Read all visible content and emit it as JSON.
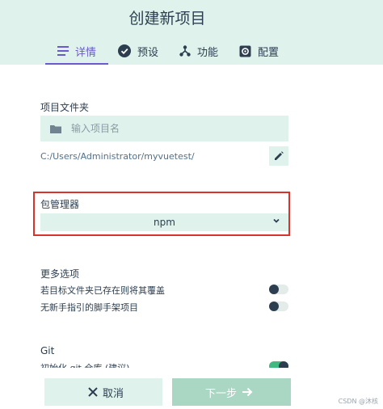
{
  "header": {
    "title": "创建新项目"
  },
  "tabs": [
    {
      "label": "详情",
      "icon": "list-icon",
      "active": true
    },
    {
      "label": "预设",
      "icon": "check-circle-icon",
      "active": false
    },
    {
      "label": "功能",
      "icon": "tree-icon",
      "active": false
    },
    {
      "label": "配置",
      "icon": "gear-icon",
      "active": false
    }
  ],
  "project_folder": {
    "label": "项目文件夹",
    "placeholder": "输入项目名",
    "value": "",
    "path": "C:/Users/Administrator/myvuetest/"
  },
  "package_manager": {
    "label": "包管理器",
    "selected": "npm"
  },
  "more_options": {
    "label": "更多选项",
    "items": [
      {
        "label": "若目标文件夹已存在则将其覆盖",
        "enabled": false
      },
      {
        "label": "无新手指引的脚手架项目",
        "enabled": false
      }
    ]
  },
  "git": {
    "label": "Git",
    "init_label": "初始化 git 仓库 (建议)",
    "enabled": true
  },
  "footer": {
    "cancel_label": "取消",
    "next_label": "下一步"
  },
  "watermark": "CSDN @沐核",
  "colors": {
    "accent": "#42b983",
    "tab_active": "#6a5acd",
    "highlight_border": "#d9342c",
    "surface": "#dff3ec"
  }
}
